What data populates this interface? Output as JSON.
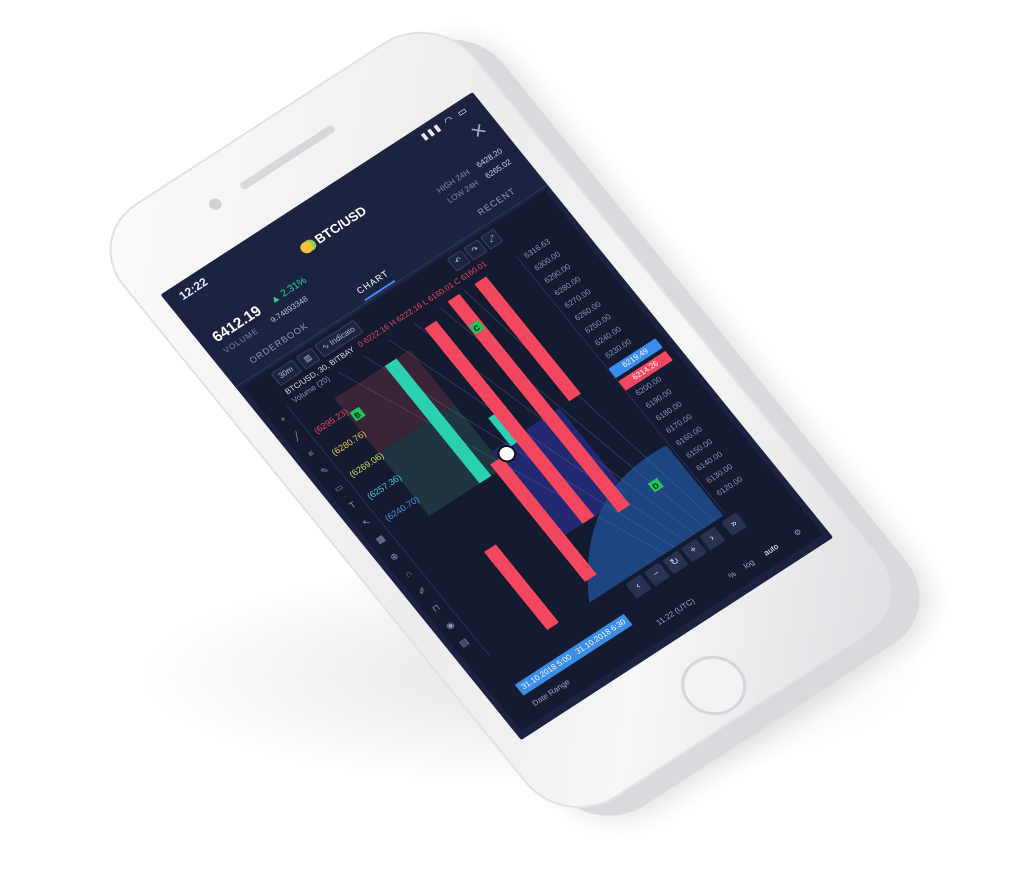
{
  "status": {
    "time": "12:22",
    "system": "▮▮▮ ◠ ▭"
  },
  "header": {
    "pair": "BTC/USD",
    "price": "6412.19",
    "change": "▲ 2.31%",
    "volume_label": "VOLUME",
    "volume_value": "9.74893348",
    "high_label": "HIGH 24H",
    "high_value": "6428.20",
    "low_label": "LOW 24H",
    "low_value": "6265.02"
  },
  "tabs": [
    {
      "label": "ORDERBOOK"
    },
    {
      "label": "CHART"
    },
    {
      "label": "RECENT"
    }
  ],
  "chart": {
    "interval": "30m",
    "indicators_label": "Indicato",
    "legend_symbol": "BTC/USD, 30, BITBAY",
    "legend_values": "0 6222.16  H 6222.16  L 6160.01  C 6160.01",
    "volume_label": "Volume (20)",
    "price_levels": [
      "(6295.23)",
      "(6280.76)",
      "(6269.06)",
      "(6257.36)",
      "(6240.70)"
    ],
    "axis_ticks": [
      "6316.63",
      "6300.00",
      "6290.00",
      "6280.00",
      "6270.00",
      "6260.00",
      "6250.00",
      "6240.00",
      "6230.00",
      "6219.49",
      "6214.26",
      "6200.00",
      "6190.00",
      "6180.00",
      "6170.00",
      "6160.00",
      "6150.00",
      "6140.00",
      "6130.00",
      "6120.00"
    ],
    "markers": [
      "B",
      "C",
      "D"
    ],
    "date_range_start": "31.10.2018 5:00",
    "date_range_end": "31.10.2018 6:30",
    "footer_date_range": "Date Range",
    "footer_time": "11:22 (UTC)",
    "footer_pct": "%",
    "footer_log": "log",
    "footer_auto": "auto",
    "colors": {
      "up": "#2ad1b0",
      "down": "#f2475f",
      "bg": "#1c2340",
      "accent": "#3c8cf0"
    }
  }
}
